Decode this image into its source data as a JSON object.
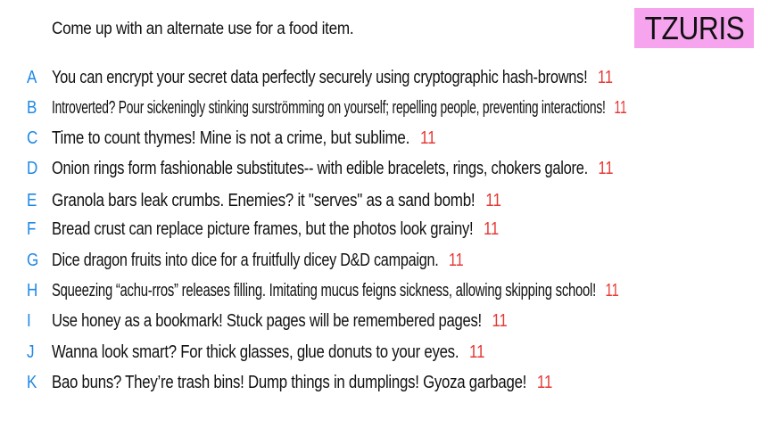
{
  "prompt": "Come up with an alternate use for a food item.",
  "title": "TZURIS",
  "answers": [
    {
      "letter": "A",
      "text": "You can encrypt your secret data perfectly securely using cryptographic hash-browns!",
      "score": "11"
    },
    {
      "letter": "B",
      "text": "Introverted? Pour sickeningly stinking surströmming on yourself; repelling people, preventing interactions!",
      "score": "11"
    },
    {
      "letter": "C",
      "text": "Time to count thymes! Mine is not a crime, but sublime.",
      "score": "11"
    },
    {
      "letter": "D",
      "text": "Onion rings form fashionable substitutes-- with edible bracelets, rings, chokers galore.",
      "score": "11"
    },
    {
      "letter": "E",
      "text": "Granola bars leak crumbs. Enemies? it \"serves\" as a sand bomb!",
      "score": "11"
    },
    {
      "letter": "F",
      "text": "Bread crust can replace picture frames, but the photos look grainy!",
      "score": "11"
    },
    {
      "letter": "G",
      "text": "Dice dragon fruits into dice for a fruitfully dicey D&D campaign.",
      "score": "11"
    },
    {
      "letter": "H",
      "text": "Squeezing “achu-rros” releases filling. Imitating mucus feigns sickness, allowing skipping school!",
      "score": "11"
    },
    {
      "letter": "I",
      "text": "Use honey as a bookmark! Stuck pages will be remembered pages!",
      "score": "11"
    },
    {
      "letter": "J",
      "text": "Wanna look smart? For thick glasses, glue donuts to your eyes.",
      "score": "11"
    },
    {
      "letter": "K",
      "text": "Bao buns? They’re trash bins! Dump things in dumplings! Gyoza garbage!",
      "score": "11"
    }
  ]
}
